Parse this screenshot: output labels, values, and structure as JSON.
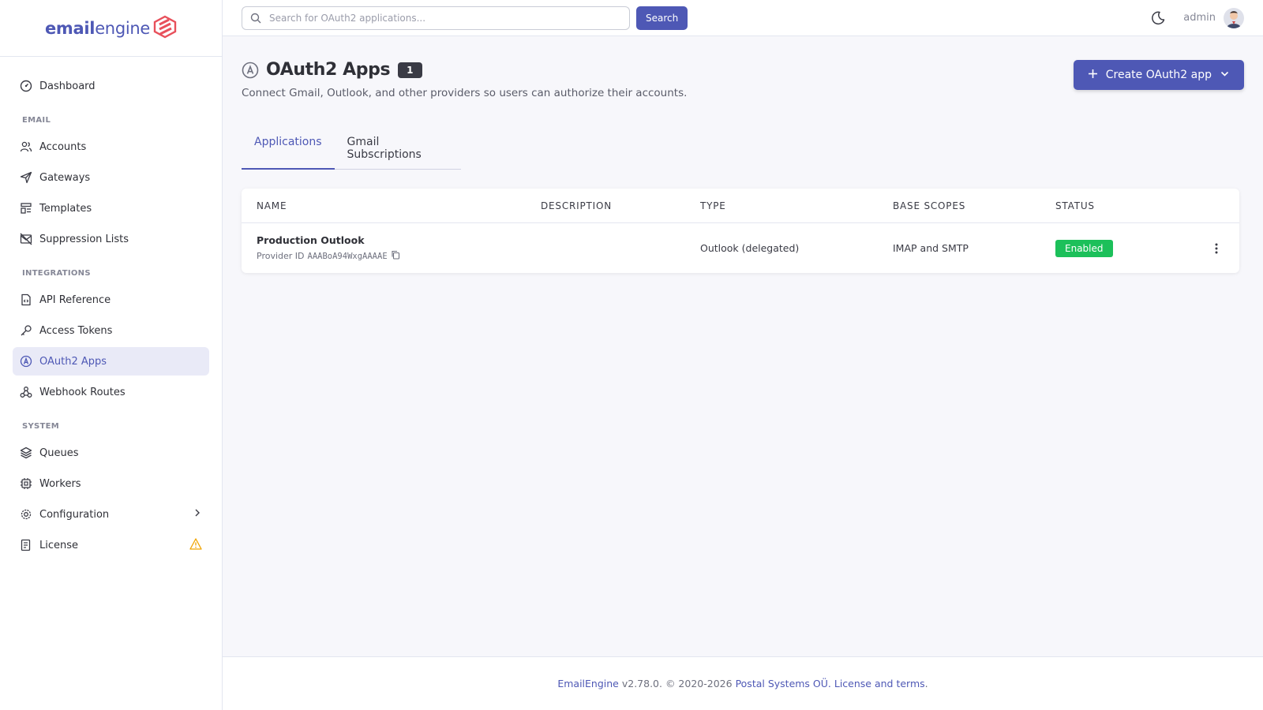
{
  "brand": {
    "part1": "email",
    "part2": "engine"
  },
  "sidebar": {
    "dashboard": "Dashboard",
    "sections": {
      "email": "EMAIL",
      "integrations": "INTEGRATIONS",
      "system": "SYSTEM"
    },
    "email_items": [
      "Accounts",
      "Gateways",
      "Templates",
      "Suppression Lists"
    ],
    "integration_items": [
      "API Reference",
      "Access Tokens",
      "OAuth2 Apps",
      "Webhook Routes"
    ],
    "system_items": [
      "Queues",
      "Workers",
      "Configuration",
      "License"
    ],
    "active": "OAuth2 Apps"
  },
  "topbar": {
    "search_placeholder": "Search for OAuth2 applications...",
    "search_button": "Search",
    "username": "admin"
  },
  "page": {
    "title": "OAuth2 Apps",
    "count": "1",
    "subtitle": "Connect Gmail, Outlook, and other providers so users can authorize their accounts.",
    "create_button": "Create OAuth2 app"
  },
  "tabs": [
    "Applications",
    "Gmail Subscriptions"
  ],
  "table": {
    "headers": [
      "NAME",
      "DESCRIPTION",
      "TYPE",
      "BASE SCOPES",
      "STATUS"
    ],
    "rows": [
      {
        "name": "Production Outlook",
        "provider_label": "Provider ID",
        "provider_id": "AAABoA94WxgAAAAE",
        "description": "",
        "type": "Outlook (delegated)",
        "scopes": "IMAP and SMTP",
        "status": "Enabled"
      }
    ]
  },
  "footer": {
    "product": "EmailEngine",
    "version": "v2.78.0. © 2020-2026",
    "company": "Postal Systems OÜ.",
    "license": "License and terms",
    "period": "."
  },
  "colors": {
    "accent": "#4e58b5",
    "success": "#1cc05a",
    "warning": "#f0a400"
  }
}
